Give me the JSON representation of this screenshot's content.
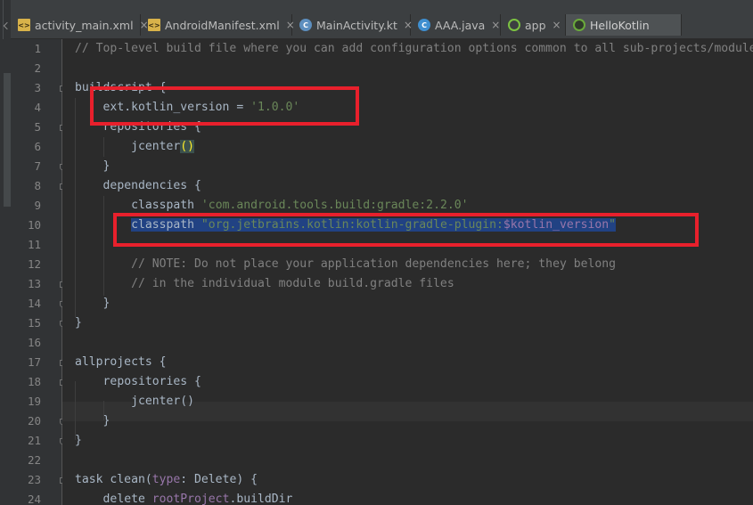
{
  "tabs": [
    {
      "label": "activity_main.xml",
      "icon": "xml-file-icon",
      "glyph": "<>"
    },
    {
      "label": "AndroidManifest.xml",
      "icon": "manifest-file-icon",
      "glyph": "<>"
    },
    {
      "label": "MainActivity.kt",
      "icon": "kotlin-class-icon",
      "glyph": "C"
    },
    {
      "label": "AAA.java",
      "icon": "java-class-icon",
      "glyph": "C"
    },
    {
      "label": "app",
      "icon": "gradle-icon",
      "glyph": ""
    },
    {
      "label": "HelloKotlin",
      "icon": "gradle-icon",
      "glyph": "",
      "active": true
    }
  ],
  "tab_close_glyph": "×",
  "line_numbers": [
    "1",
    "2",
    "3",
    "4",
    "5",
    "6",
    "7",
    "8",
    "9",
    "10",
    "11",
    "12",
    "13",
    "14",
    "15",
    "16",
    "17",
    "18",
    "19",
    "20",
    "21",
    "22",
    "23",
    "24"
  ],
  "code": {
    "l1": "// Top-level build file where you can add configuration options common to all sub-projects/modules.",
    "l3": "buildscript {",
    "l4a": "ext.kotlin_version = ",
    "l4b": "'1.0.0'",
    "l5": "repositories {",
    "l6a": "jcenter",
    "l6b": "(",
    "l6c": ")",
    "l7": "}",
    "l8": "dependencies {",
    "l9a": "classpath ",
    "l9b": "'com.android.tools.build:gradle:2.2.0'",
    "l10a": "classpath ",
    "l10b": "\"org.jetbrains.kotlin:kotlin-gradle-plugin:",
    "l10c": "$kotlin_version",
    "l10d": "\"",
    "l12": "// NOTE: Do not place your application dependencies here; they belong",
    "l13": "// in the individual module build.gradle files",
    "l14": "}",
    "l15": "}",
    "l17": "allprojects {",
    "l18": "repositories {",
    "l19": "jcenter()",
    "l20": "}",
    "l21": "}",
    "l23a": "task clean(",
    "l23b": "type",
    "l23c": ": Delete) {",
    "l24a": "delete ",
    "l24b": "rootProject",
    "l24c": ".buildDir"
  },
  "colors": {
    "comment": "#808080",
    "string": "#6a8759",
    "keyword": "#cc7832",
    "property": "#9876aa",
    "annotation_box": "#e8202c"
  }
}
